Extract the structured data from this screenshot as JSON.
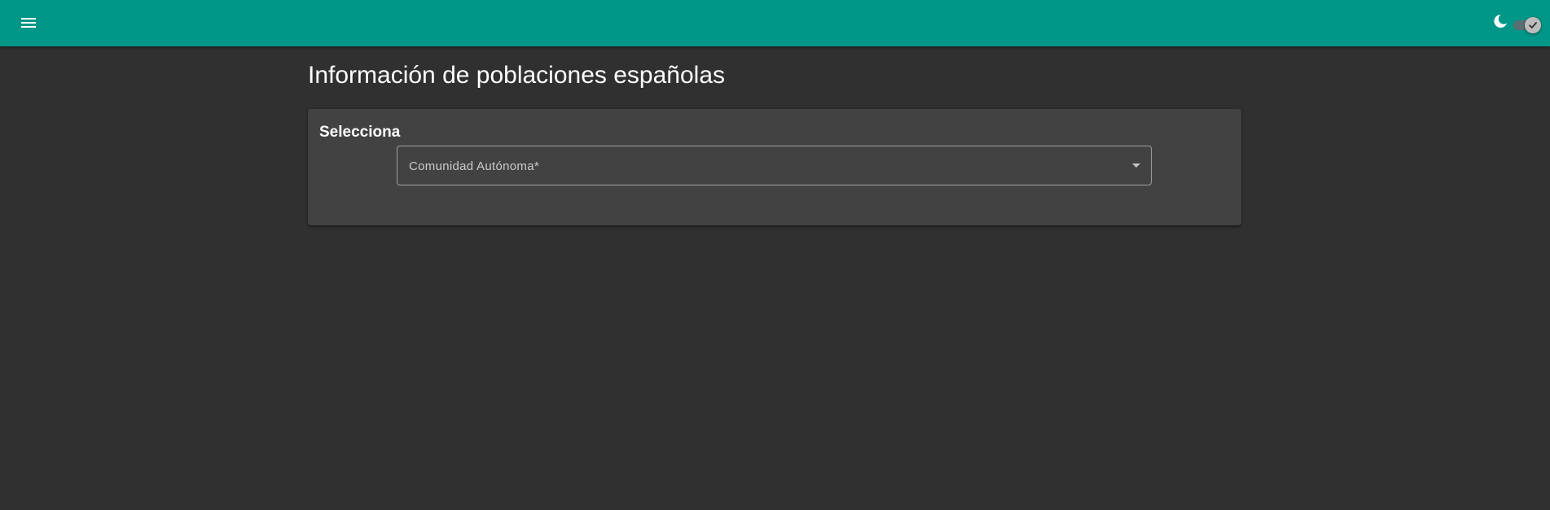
{
  "toolbar": {
    "menu_icon": "menu-icon",
    "theme_icon": "moon-icon",
    "theme_toggle": "dark-mode-toggle",
    "theme_toggle_checked": true,
    "background_color": "#009688"
  },
  "page": {
    "title": "Información de poblaciones españolas",
    "background_color": "#303030"
  },
  "card": {
    "title": "Selecciona",
    "select": {
      "placeholder": "Comunidad Autónoma*",
      "value": "",
      "arrow_icon": "dropdown-arrow-icon"
    }
  }
}
